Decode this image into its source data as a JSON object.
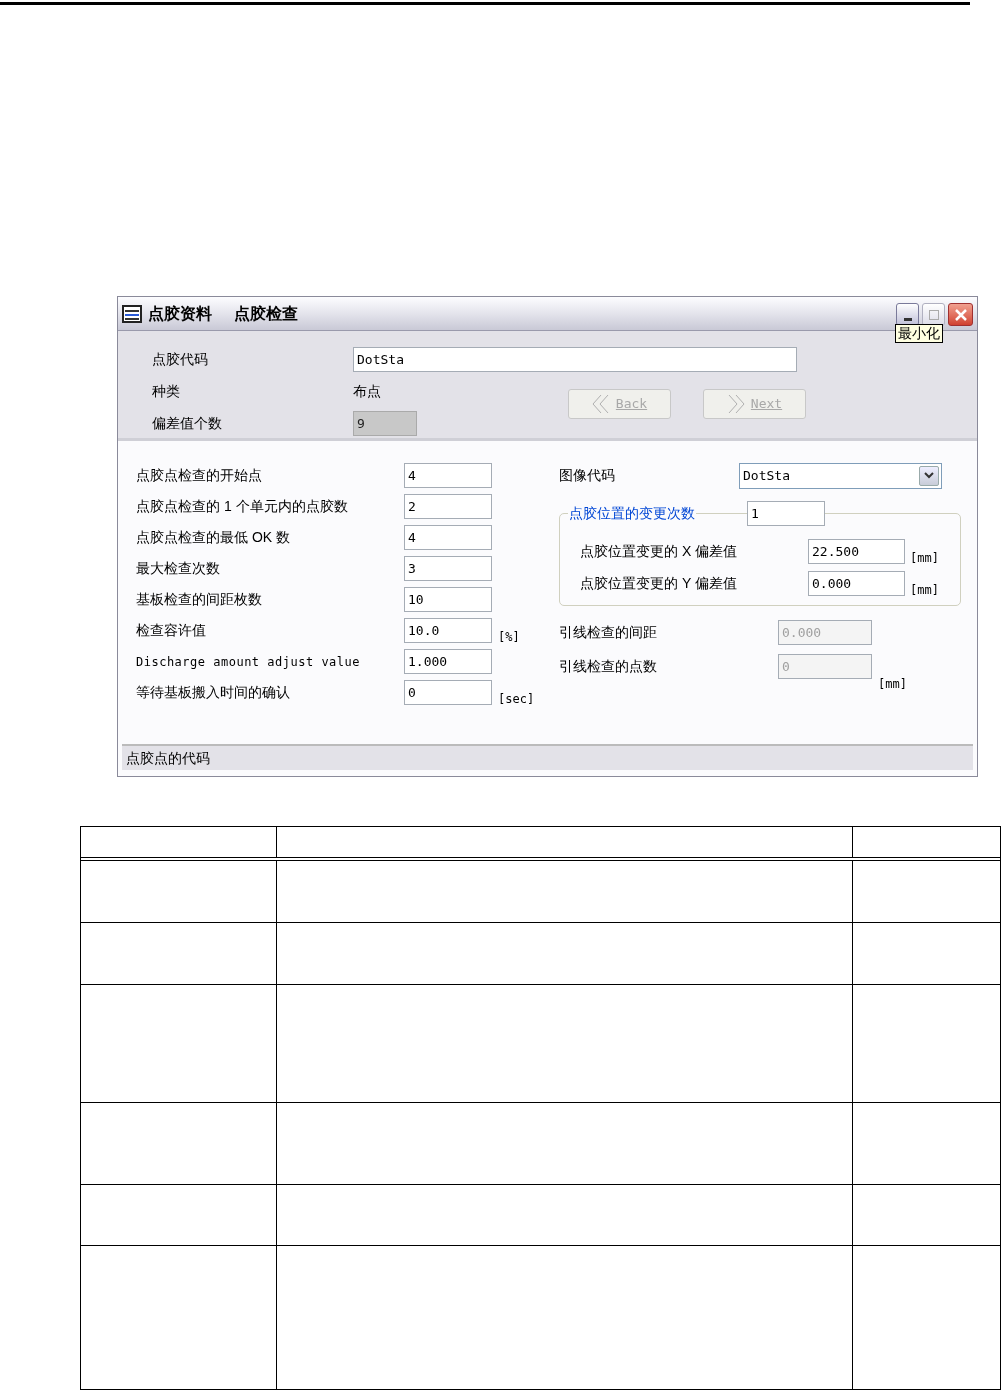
{
  "window": {
    "title_parts": [
      "点胶资料",
      "点胶检查"
    ],
    "tooltip": "最小化"
  },
  "header": {
    "fields": [
      {
        "label": "点胶代码",
        "kind": "input",
        "value": "DotSta",
        "disabled": false
      },
      {
        "label": "种类",
        "kind": "text",
        "value": "布点"
      },
      {
        "label": "偏差值个数",
        "kind": "input",
        "value": "9",
        "disabled": true
      }
    ],
    "buttons": [
      {
        "label": "Back",
        "disabled": true
      },
      {
        "label": "Next",
        "disabled": true
      }
    ]
  },
  "left_fields": [
    {
      "label": "点胶点检查的开始点",
      "value": "4"
    },
    {
      "label": "点胶点检查的 1 个单元内的点胶数",
      "value": "2"
    },
    {
      "label": "点胶点检查的最低 OK 数",
      "value": "4"
    },
    {
      "label": "最大检查次数",
      "value": "3"
    },
    {
      "label": "基板检查的间距枚数",
      "value": "10"
    },
    {
      "label": "检查容许值",
      "value": "10.0",
      "unit": "[%]"
    },
    {
      "label": "Discharge amount adjust value",
      "value": "1.000",
      "mono_label": true
    },
    {
      "label": "等待基板搬入时间的确认",
      "value": "0",
      "unit": "[sec]"
    }
  ],
  "image_code": {
    "label": "图像代码",
    "value": "DotSta"
  },
  "position_group": {
    "legend": "点胶位置的变更次数",
    "value": "1",
    "rows": [
      {
        "label": "点胶位置变更的 X 偏差值",
        "value": "22.500",
        "unit": "[mm]"
      },
      {
        "label": "点胶位置变更的 Y 偏差值",
        "value": "0.000",
        "unit": "[mm]"
      }
    ]
  },
  "lead_fields": [
    {
      "label": "引线检查的间距",
      "value": "0.000",
      "disabled": true
    },
    {
      "label": "引线检查的点数",
      "value": "0",
      "disabled": true,
      "unit": "[mm]"
    }
  ],
  "status_bar": "点胶点的代码"
}
